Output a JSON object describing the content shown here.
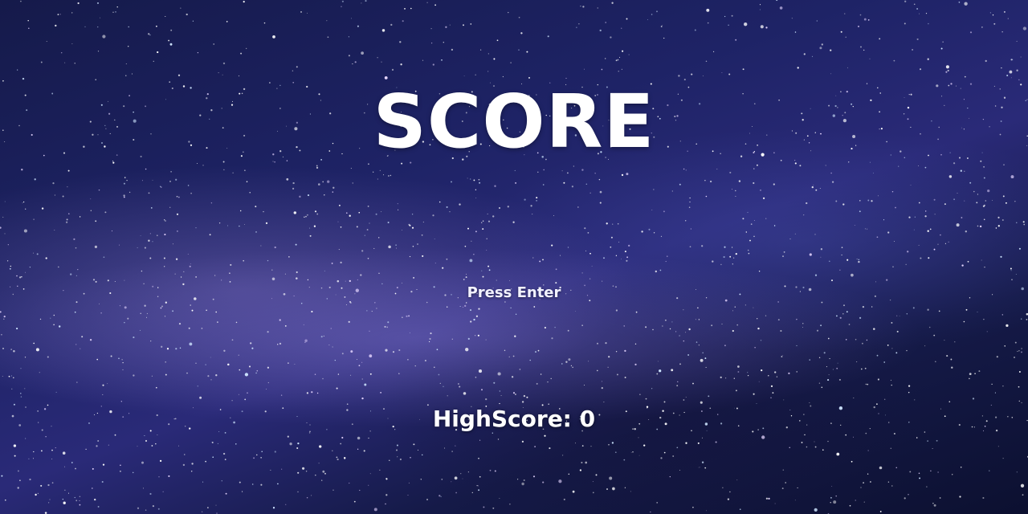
{
  "screen": {
    "title": "SCORE",
    "prompt": "Press Enter",
    "highscore_label": "HighScore:",
    "highscore_value": "0"
  },
  "background": {
    "type": "starfield",
    "colors": {
      "sky_dark": "#0c1030",
      "sky_mid": "#1e2366",
      "milky_way": "#9b8fd6",
      "text": "#ffffff"
    }
  }
}
